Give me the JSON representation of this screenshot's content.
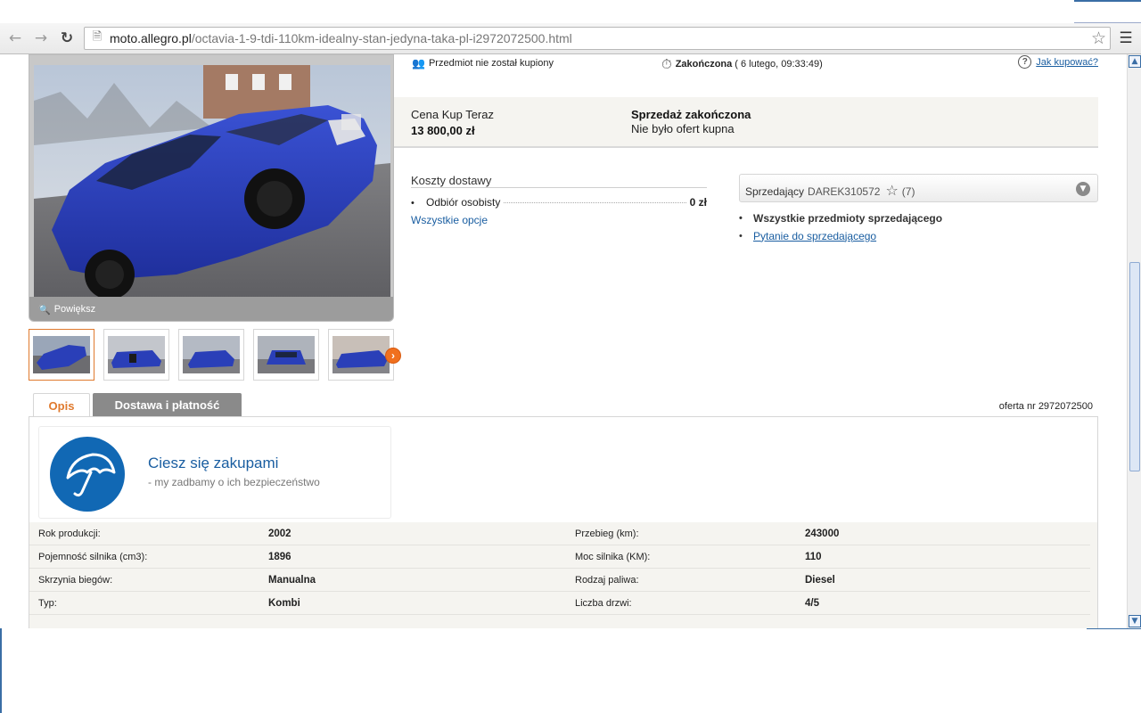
{
  "browser": {
    "url_host": "moto.allegro.pl",
    "url_path": "/octavia-1-9-tdi-110km-idealny-stan-jedyna-taka-pl-i2972072500.html"
  },
  "status": {
    "not_bought": "Przedmiot nie został kupiony",
    "ended_label": "Zakończona",
    "ended_date": "( 6 lutego, 09:33:49)",
    "how_to_buy": "Jak kupować?"
  },
  "price": {
    "buy_now_label": "Cena Kup Teraz",
    "buy_now_value": "13 800,00 zł",
    "sale_ended": "Sprzedaż zakończona",
    "no_offers": "Nie było ofert kupna"
  },
  "gallery": {
    "zoom_label": "Powiększ"
  },
  "delivery": {
    "title": "Koszty dostawy",
    "option_label": "Odbiór osobisty",
    "option_cost": "0 zł",
    "all_options": "Wszystkie opcje"
  },
  "seller": {
    "label": "Sprzedający",
    "login": "DAREK310572",
    "rating": "(7)",
    "all_items": "Wszystkie przedmioty sprzedającego",
    "ask": "Pytanie do sprzedającego"
  },
  "tabs": {
    "description": "Opis",
    "delivery_payment": "Dostawa i płatność"
  },
  "offer_number": "oferta nr 2972072500",
  "promo": {
    "headline": "Ciesz się zakupami",
    "sub": "-  my zadbamy o ich bezpieczeństwo"
  },
  "specs": [
    {
      "label_left": "Rok produkcji:",
      "value_left": "2002",
      "label_right": "Przebieg (km):",
      "value_right": "243000"
    },
    {
      "label_left": "Pojemność silnika (cm3):",
      "value_left": "1896",
      "label_right": "Moc silnika (KM):",
      "value_right": "110"
    },
    {
      "label_left": "Skrzynia biegów:",
      "value_left": "Manualna",
      "label_right": "Rodzaj paliwa:",
      "value_right": "Diesel"
    },
    {
      "label_left": "Typ:",
      "value_left": "Kombi",
      "label_right": "Liczba drzwi:",
      "value_right": "4/5"
    }
  ],
  "colors": {
    "link": "#1a5ea1",
    "accent_orange": "#e07a2e",
    "promo_blue": "#1168b4",
    "car_blue": "#2a3fb8"
  }
}
